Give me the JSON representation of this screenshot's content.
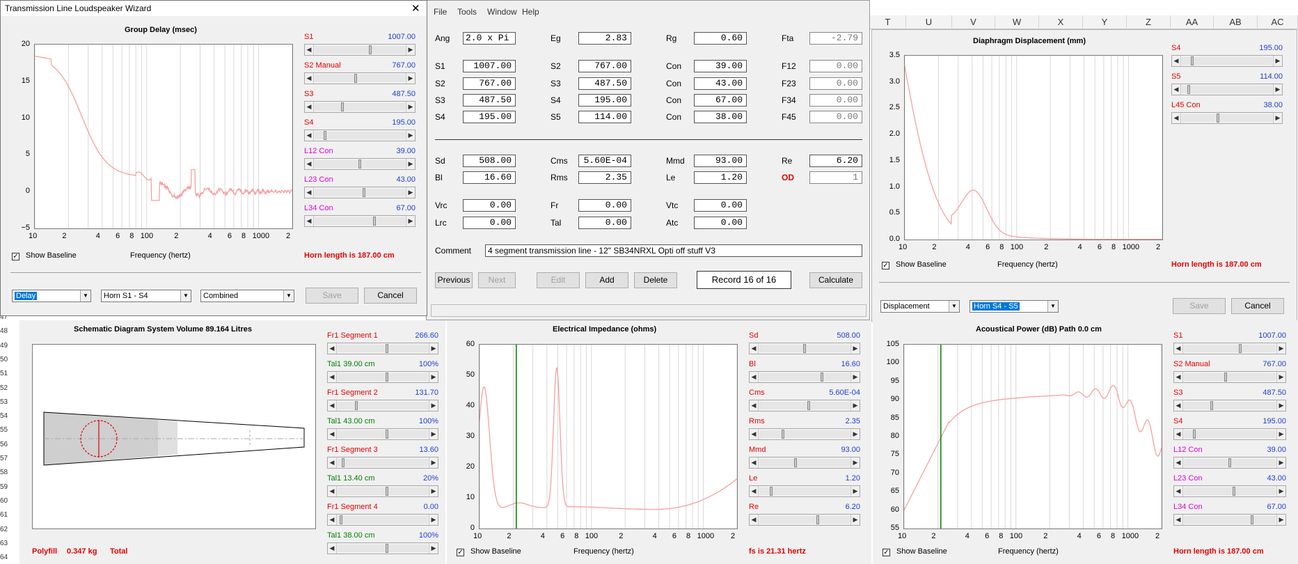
{
  "wizard": {
    "title": "Transmission Line Loudspeaker Wizard",
    "close": "✕",
    "show_baseline": "Show Baseline",
    "combo_type": "Delay",
    "combo_horn": "Horn S1 - S4",
    "combo_mode": "Combined",
    "save": "Save",
    "cancel": "Cancel"
  },
  "group_delay": {
    "title": "Group Delay (msec)",
    "xlabel": "Frequency (hertz)",
    "footer": "Horn length is 187.00 cm",
    "yticks": [
      "20",
      "15",
      "10",
      "5",
      "0",
      "−5"
    ],
    "xticks": [
      "10",
      "2",
      "4",
      "6",
      "8",
      "100",
      "2",
      "4",
      "6",
      "8",
      "1000",
      "2"
    ],
    "sliders": [
      {
        "label": "S1",
        "value": "1007.00",
        "color": "red",
        "pos": 0.62
      },
      {
        "label": "S2  Manual",
        "value": "767.00",
        "color": "red",
        "pos": 0.45
      },
      {
        "label": "S3",
        "value": "487.50",
        "color": "red",
        "pos": 0.3
      },
      {
        "label": "S4",
        "value": "195.00",
        "color": "red",
        "pos": 0.1
      },
      {
        "label": "L12  Con",
        "value": "39.00",
        "color": "mag",
        "pos": 0.5
      },
      {
        "label": "L23  Con",
        "value": "43.00",
        "color": "mag",
        "pos": 0.55
      },
      {
        "label": "L34  Con",
        "value": "67.00",
        "color": "mag",
        "pos": 0.67
      }
    ]
  },
  "menu": [
    "File",
    "Tools",
    "Window",
    "Help"
  ],
  "params": {
    "rows1": [
      [
        {
          "l": "Ang",
          "v": "2.0 x Pi",
          "left": true
        },
        {
          "l": "Eg",
          "v": "2.83"
        },
        {
          "l": "Rg",
          "v": "0.60"
        },
        {
          "l": "Fta",
          "v": "-2.79",
          "dis": true
        }
      ],
      [
        {
          "l": "S1",
          "v": "1007.00"
        },
        {
          "l": "S2",
          "v": "767.00"
        },
        {
          "l": "Con",
          "v": "39.00"
        },
        {
          "l": "F12",
          "v": "0.00",
          "dis": true
        }
      ],
      [
        {
          "l": "S2",
          "v": "767.00"
        },
        {
          "l": "S3",
          "v": "487.50"
        },
        {
          "l": "Con",
          "v": "43.00"
        },
        {
          "l": "F23",
          "v": "0.00",
          "dis": true
        }
      ],
      [
        {
          "l": "S3",
          "v": "487.50"
        },
        {
          "l": "S4",
          "v": "195.00"
        },
        {
          "l": "Con",
          "v": "67.00"
        },
        {
          "l": "F34",
          "v": "0.00",
          "dis": true
        }
      ],
      [
        {
          "l": "S4",
          "v": "195.00"
        },
        {
          "l": "S5",
          "v": "114.00"
        },
        {
          "l": "Con",
          "v": "38.00"
        },
        {
          "l": "F45",
          "v": "0.00",
          "dis": true
        }
      ]
    ],
    "rows2": [
      [
        {
          "l": "Sd",
          "v": "508.00"
        },
        {
          "l": "Cms",
          "v": "5.60E-04"
        },
        {
          "l": "Mmd",
          "v": "93.00"
        },
        {
          "l": "Re",
          "v": "6.20"
        }
      ],
      [
        {
          "l": "Bl",
          "v": "16.60"
        },
        {
          "l": "Rms",
          "v": "2.35"
        },
        {
          "l": "Le",
          "v": "1.20"
        },
        {
          "l": "OD",
          "v": "1",
          "red": true,
          "dis": true
        }
      ]
    ],
    "rows3": [
      [
        {
          "l": "Vrc",
          "v": "0.00"
        },
        {
          "l": "Fr",
          "v": "0.00"
        },
        {
          "l": "Vtc",
          "v": "0.00"
        }
      ],
      [
        {
          "l": "Lrc",
          "v": "0.00"
        },
        {
          "l": "Tal",
          "v": "0.00"
        },
        {
          "l": "Atc",
          "v": "0.00"
        }
      ]
    ],
    "comment_label": "Comment",
    "comment": "4 segment transmission line - 12\" SB34NRXL Opti off stuff  V3",
    "previous": "Previous",
    "next": "Next",
    "edit": "Edit",
    "add": "Add",
    "delete": "Delete",
    "record": "Record 16 of 16",
    "calculate": "Calculate"
  },
  "sheet": {
    "cols": [
      "T",
      "U",
      "V",
      "W",
      "X",
      "Y",
      "Z",
      "AA",
      "AB",
      "AC"
    ],
    "rows": [
      "47",
      "48",
      "49",
      "50",
      "51",
      "52",
      "53",
      "54",
      "55",
      "56",
      "57",
      "58",
      "59",
      "60",
      "61",
      "62",
      "63",
      "64"
    ]
  },
  "displacement": {
    "title": "Diaphragm Displacement (mm)",
    "xlabel": "Frequency (hertz)",
    "footer": "Horn length is 187.00 cm",
    "show_baseline": "Show Baseline",
    "combo_type": "Displacement",
    "combo_horn": "Horn S4 - S5",
    "save": "Save",
    "cancel": "Cancel",
    "yticks": [
      "3.5",
      "3.0",
      "2.5",
      "2.0",
      "1.5",
      "1.0",
      "0.5",
      "0.0"
    ],
    "xticks": [
      "10",
      "2",
      "4",
      "6",
      "8",
      "100",
      "2",
      "4",
      "6",
      "8",
      "1000",
      "2"
    ],
    "sliders": [
      {
        "label": "S4",
        "value": "195.00",
        "color": "red",
        "pos": 0.1
      },
      {
        "label": "S5",
        "value": "114.00",
        "color": "red",
        "pos": 0.06
      },
      {
        "label": "L45  Con",
        "value": "38.00",
        "color": "red",
        "pos": 0.4
      }
    ]
  },
  "schematic": {
    "title": "Schematic Diagram   System Volume 89.164 Litres",
    "footer_label": "Polyfill",
    "footer_value": "0.347 kg",
    "footer_total": "Total",
    "sliders": [
      {
        "label": "Fr1  Segment 1",
        "value": "266.60",
        "color": "red",
        "pos": 0.55
      },
      {
        "label": "Tal1  39.00 cm",
        "value": "100%",
        "color": "grn",
        "pos": 0.55
      },
      {
        "label": "Fr1  Segment 2",
        "value": "131.70",
        "color": "red",
        "pos": 0.2
      },
      {
        "label": "Tal1  43.00 cm",
        "value": "100%",
        "color": "grn",
        "pos": 0.55
      },
      {
        "label": "Fr1  Segment 3",
        "value": "13.60",
        "color": "red",
        "pos": 0.05
      },
      {
        "label": "Tal1  13.40 cm",
        "value": "20%",
        "color": "grn",
        "pos": 0.55
      },
      {
        "label": "Fr1  Segment 4",
        "value": "0.00",
        "color": "red",
        "pos": 0.02
      },
      {
        "label": "Tal1  38.00 cm",
        "value": "100%",
        "color": "grn",
        "pos": 0.55
      }
    ]
  },
  "impedance": {
    "title": "Electrical Impedance (ohms)",
    "xlabel": "Frequency (hertz)",
    "footer": "fs is 21.31 hertz",
    "show_baseline": "Show Baseline",
    "yticks": [
      "60",
      "50",
      "40",
      "30",
      "20",
      "10",
      "0"
    ],
    "xticks": [
      "10",
      "2",
      "4",
      "6",
      "8",
      "100",
      "2",
      "4",
      "6",
      "8",
      "1000",
      "2"
    ],
    "sliders": [
      {
        "label": "Sd",
        "value": "508.00",
        "color": "red",
        "pos": 0.5
      },
      {
        "label": "Bl",
        "value": "16.60",
        "color": "red",
        "pos": 0.7
      },
      {
        "label": "Cms",
        "value": "5.60E-04",
        "color": "red",
        "pos": 0.55
      },
      {
        "label": "Rms",
        "value": "2.35",
        "color": "red",
        "pos": 0.25
      },
      {
        "label": "Mmd",
        "value": "93.00",
        "color": "red",
        "pos": 0.4
      },
      {
        "label": "Le",
        "value": "1.20",
        "color": "red",
        "pos": 0.12
      },
      {
        "label": "Re",
        "value": "6.20",
        "color": "red",
        "pos": 0.65
      }
    ]
  },
  "acoustic": {
    "title": "Acoustical Power (dB)   Path 0.0 cm",
    "xlabel": "Frequency (hertz)",
    "footer": "Horn length is 187.00 cm",
    "show_baseline": "Show Baseline",
    "yticks": [
      "105",
      "100",
      "95",
      "90",
      "85",
      "80",
      "75",
      "70",
      "65",
      "60",
      "55"
    ],
    "xticks": [
      "10",
      "2",
      "4",
      "6",
      "8",
      "100",
      "2",
      "4",
      "6",
      "8",
      "1000",
      "2"
    ],
    "sliders": [
      {
        "label": "S1",
        "value": "1007.00",
        "color": "red",
        "pos": 0.62
      },
      {
        "label": "S2  Manual",
        "value": "767.00",
        "color": "red",
        "pos": 0.45
      },
      {
        "label": "S3",
        "value": "487.50",
        "color": "red",
        "pos": 0.3
      },
      {
        "label": "S4",
        "value": "195.00",
        "color": "red",
        "pos": 0.1
      },
      {
        "label": "L12  Con",
        "value": "39.00",
        "color": "mag",
        "pos": 0.5
      },
      {
        "label": "L23  Con",
        "value": "43.00",
        "color": "mag",
        "pos": 0.55
      },
      {
        "label": "L34  Con",
        "value": "67.00",
        "color": "mag",
        "pos": 0.75
      }
    ]
  },
  "colors": {
    "curve": "#f4a0a0",
    "fs_line": "#008000",
    "grid": "#d8d8d8",
    "accent": "#0078d7"
  }
}
